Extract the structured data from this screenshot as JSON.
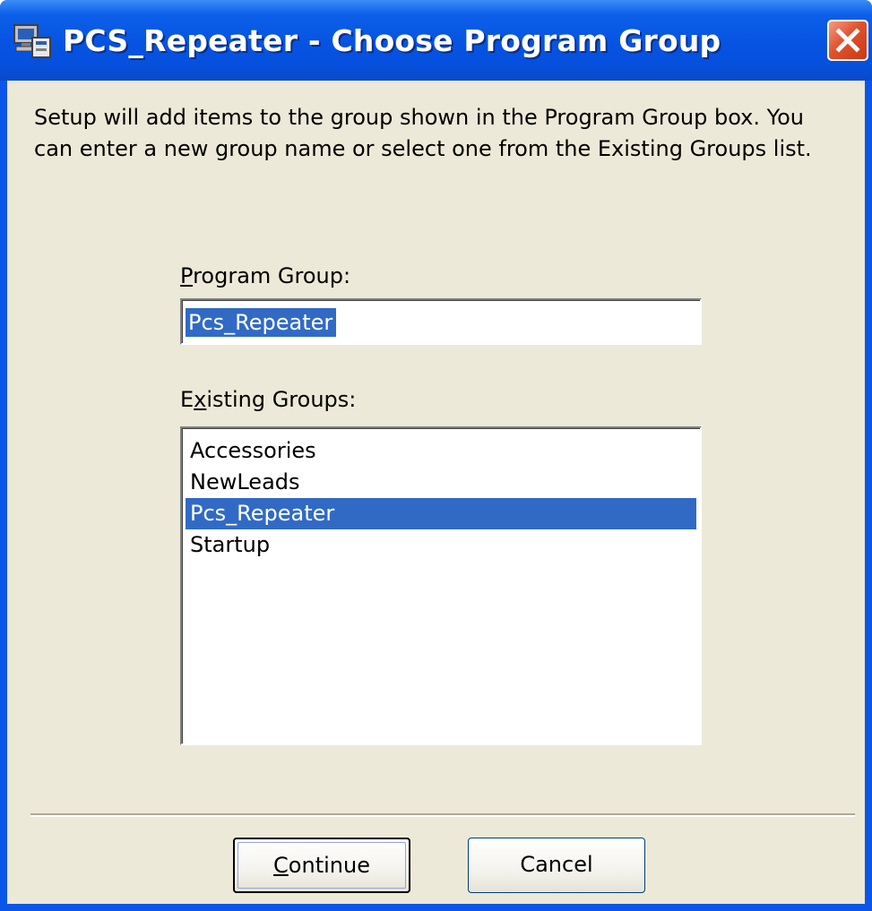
{
  "window": {
    "title": "PCS_Repeater - Choose Program Group",
    "title_icon": "setup-computer-icon",
    "close_icon": "close-icon"
  },
  "intro_text": "Setup will add items to the group shown in the Program Group box. You can enter a new group name or select one from the Existing Groups list.",
  "program_group": {
    "label_pre": "",
    "label_key": "P",
    "label_post": "rogram Group:",
    "value": "Pcs_Repeater"
  },
  "existing_groups": {
    "label_pre": "E",
    "label_key": "x",
    "label_post": "isting Groups:",
    "items": [
      "Accessories",
      "NewLeads",
      "Pcs_Repeater",
      "Startup"
    ],
    "selected": "Pcs_Repeater"
  },
  "buttons": {
    "continue_key": "C",
    "continue_rest": "ontinue",
    "cancel": "Cancel"
  },
  "colors": {
    "titlebar": "#0753e1",
    "dialog_bg": "#ece9d8",
    "selection": "#316ac5"
  }
}
